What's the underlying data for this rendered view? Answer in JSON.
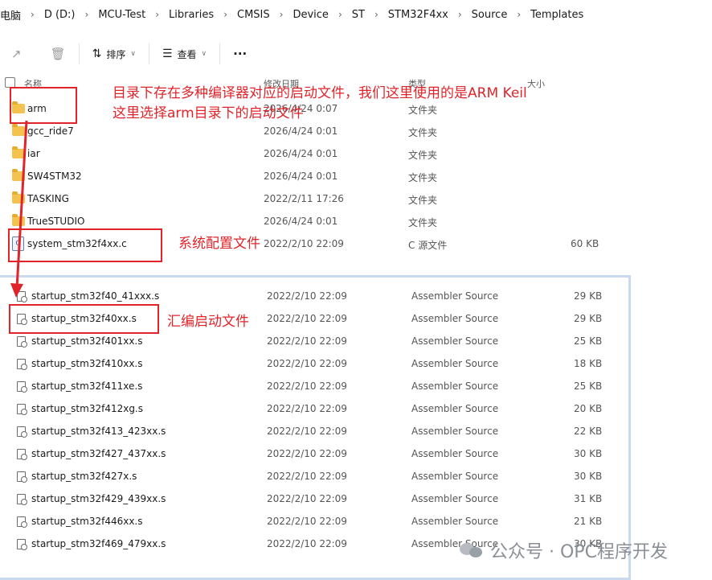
{
  "breadcrumb": [
    "电脑",
    "D (D:)",
    "MCU-Test",
    "Libraries",
    "CMSIS",
    "Device",
    "ST",
    "STM32F4xx",
    "Source",
    "Templates"
  ],
  "toolbar": {
    "sort_label": "排序",
    "view_label": "查看",
    "more_label": "···"
  },
  "columns": {
    "name": "名称",
    "modified": "修改日期",
    "type": "类型",
    "size": "大小"
  },
  "top_rows": [
    {
      "name": "arm",
      "date": "2026/4/24 0:07",
      "type": "文件夹",
      "size": "",
      "icon": "folder"
    },
    {
      "name": "gcc_ride7",
      "date": "2026/4/24 0:01",
      "type": "文件夹",
      "size": "",
      "icon": "folder"
    },
    {
      "name": "iar",
      "date": "2026/4/24 0:01",
      "type": "文件夹",
      "size": "",
      "icon": "folder"
    },
    {
      "name": "SW4STM32",
      "date": "2026/4/24 0:01",
      "type": "文件夹",
      "size": "",
      "icon": "folder"
    },
    {
      "name": "TASKING",
      "date": "2022/2/11 17:26",
      "type": "文件夹",
      "size": "",
      "icon": "folder"
    },
    {
      "name": "TrueSTUDIO",
      "date": "2026/4/24 0:01",
      "type": "文件夹",
      "size": "",
      "icon": "folder"
    },
    {
      "name": "system_stm32f4xx.c",
      "date": "2022/2/10 22:09",
      "type": "C 源文件",
      "size": "60 KB",
      "icon": "c-file"
    }
  ],
  "bottom_rows": [
    {
      "name": "startup_stm32f40_41xxx.s",
      "date": "2022/2/10 22:09",
      "type": "Assembler Source",
      "size": "29 KB"
    },
    {
      "name": "startup_stm32f40xx.s",
      "date": "2022/2/10 22:09",
      "type": "Assembler Source",
      "size": "29 KB"
    },
    {
      "name": "startup_stm32f401xx.s",
      "date": "2022/2/10 22:09",
      "type": "Assembler Source",
      "size": "25 KB"
    },
    {
      "name": "startup_stm32f410xx.s",
      "date": "2022/2/10 22:09",
      "type": "Assembler Source",
      "size": "18 KB"
    },
    {
      "name": "startup_stm32f411xe.s",
      "date": "2022/2/10 22:09",
      "type": "Assembler Source",
      "size": "25 KB"
    },
    {
      "name": "startup_stm32f412xg.s",
      "date": "2022/2/10 22:09",
      "type": "Assembler Source",
      "size": "20 KB"
    },
    {
      "name": "startup_stm32f413_423xx.s",
      "date": "2022/2/10 22:09",
      "type": "Assembler Source",
      "size": "22 KB"
    },
    {
      "name": "startup_stm32f427_437xx.s",
      "date": "2022/2/10 22:09",
      "type": "Assembler Source",
      "size": "30 KB"
    },
    {
      "name": "startup_stm32f427x.s",
      "date": "2022/2/10 22:09",
      "type": "Assembler Source",
      "size": "30 KB"
    },
    {
      "name": "startup_stm32f429_439xx.s",
      "date": "2022/2/10 22:09",
      "type": "Assembler Source",
      "size": "31 KB"
    },
    {
      "name": "startup_stm32f446xx.s",
      "date": "2022/2/10 22:09",
      "type": "Assembler Source",
      "size": "21 KB"
    },
    {
      "name": "startup_stm32f469_479xx.s",
      "date": "2022/2/10 22:09",
      "type": "Assembler Source",
      "size": "30 KB"
    }
  ],
  "annotations": {
    "line1": "目录下存在多种编译器对应的启动文件，我们这里使用的是ARM Keil",
    "line2": "这里选择arm目录下的启动文件",
    "system_file": "系统配置文件",
    "startup_file": "汇编启动文件",
    "color": "#e0242a"
  },
  "watermark": {
    "text": "公众号 · OPC程序开发"
  }
}
